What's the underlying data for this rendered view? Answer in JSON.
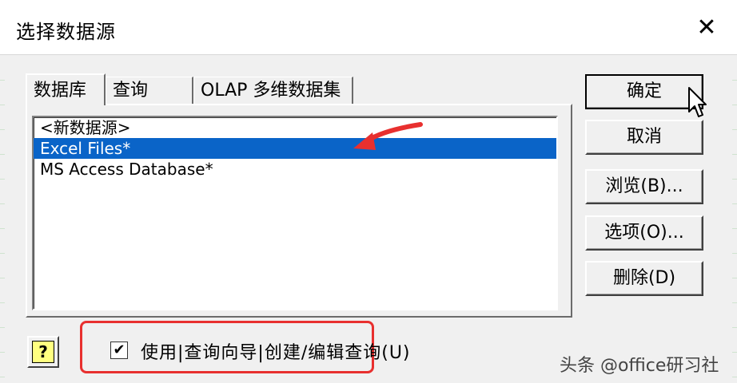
{
  "dialog": {
    "title": "选择数据源",
    "close_icon": "close-icon"
  },
  "tabs": [
    {
      "label": "数据库",
      "active": true
    },
    {
      "label": "查询",
      "active": false
    },
    {
      "label": "OLAP 多维数据集",
      "active": false
    }
  ],
  "list": {
    "items": [
      {
        "label": "<新数据源>",
        "selected": false
      },
      {
        "label": "Excel Files*",
        "selected": true
      },
      {
        "label": "MS Access Database*",
        "selected": false
      }
    ]
  },
  "buttons": {
    "ok": "确定",
    "cancel": "取消",
    "browse": "浏览(B)...",
    "options": "选项(O)...",
    "delete": "删除(D)"
  },
  "help": {
    "glyph": "?"
  },
  "checkbox": {
    "checked": true,
    "label": "使用|查询向导|创建/编辑查询(U)"
  },
  "watermark": "头条 @office研习社",
  "colors": {
    "selection": "#0a64c8",
    "annotation_red": "#e8302f",
    "help_yellow": "#ffff80"
  }
}
